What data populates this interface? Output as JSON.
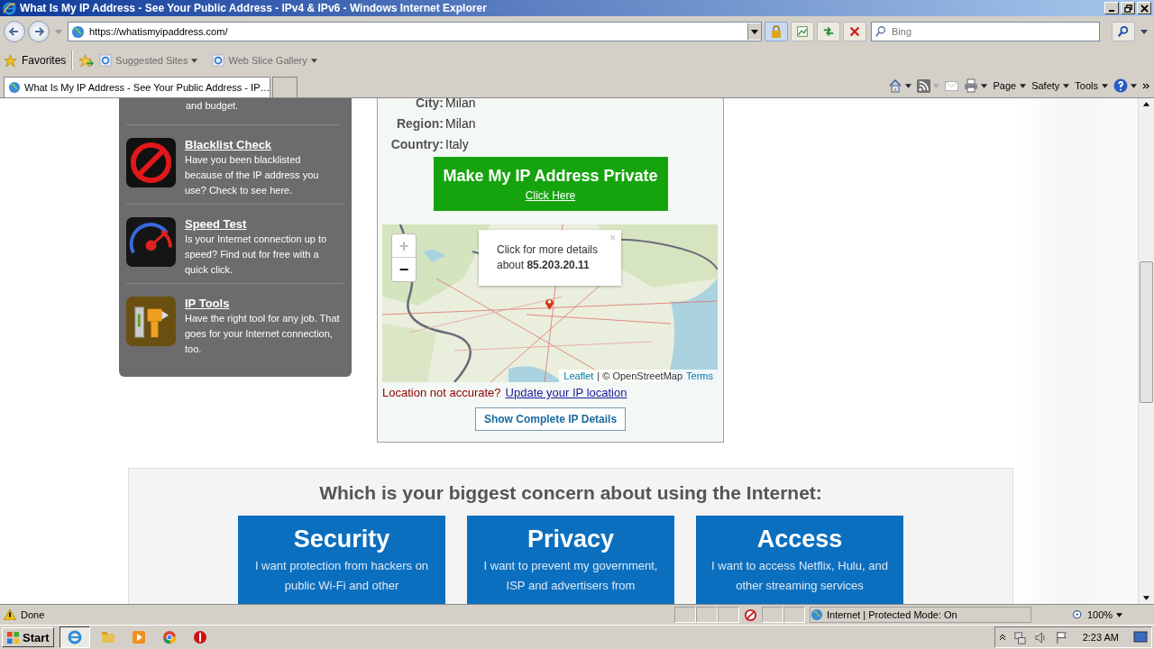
{
  "window": {
    "title": "What Is My IP Address - See Your Public Address - IPv4 & IPv6 - Windows Internet Explorer"
  },
  "address_bar": {
    "url": "https://whatismyipaddress.com/"
  },
  "search": {
    "placeholder": "Bing"
  },
  "favorites_bar": {
    "label": "Favorites",
    "links": [
      "Suggested Sites",
      "Web Slice Gallery"
    ]
  },
  "tabs": [
    {
      "title": "What Is My IP Address - See Your Public Address - IP…",
      "selected": true
    }
  ],
  "command_bar": [
    "Page",
    "Safety",
    "Tools"
  ],
  "sidebar": {
    "fragment": "and budget.",
    "items": [
      {
        "kind": "blacklist",
        "title": "Blacklist Check",
        "description": "Have you been blacklisted because of the IP address you use? Check to see here."
      },
      {
        "kind": "speed",
        "title": "Speed Test",
        "description": "Is your Internet connection up to speed? Find out for free with a quick click."
      },
      {
        "kind": "tools",
        "title": "IP Tools",
        "description": "Have the right tool for any job. That goes for your Internet connection, too."
      }
    ]
  },
  "location": {
    "rows": [
      {
        "label": "City:",
        "value": "Milan"
      },
      {
        "label": "Region:",
        "value": "Milan"
      },
      {
        "label": "Country:",
        "value": "Italy"
      }
    ],
    "cta": {
      "title": "Make My IP Address Private",
      "link": "Click Here"
    },
    "map": {
      "zoom_in": "+",
      "zoom_out": "−",
      "popup_text": "Click for more details about",
      "popup_ip": "85.203.20.11",
      "close": "×",
      "attribution_link": "Leaflet",
      "attribution": "| © OpenStreetMap",
      "terms": "Terms"
    },
    "accuracy": {
      "text": "Location not accurate?",
      "link": "Update your IP location"
    },
    "details_button": "Show Complete IP Details"
  },
  "concern": {
    "heading": "Which is your biggest concern about using the Internet:",
    "cards": [
      {
        "title": "Security",
        "text": "I want protection from hackers on public Wi-Fi and other"
      },
      {
        "title": "Privacy",
        "text": "I want to prevent my government, ISP and advertisers from"
      },
      {
        "title": "Access",
        "text": "I want to access Netflix, Hulu, and other streaming services"
      }
    ]
  },
  "status_bar": {
    "status": "Done",
    "zone": "Internet | Protected Mode: On",
    "zoom": "100%"
  },
  "taskbar": {
    "start": "Start",
    "time": "2:23 AM"
  }
}
